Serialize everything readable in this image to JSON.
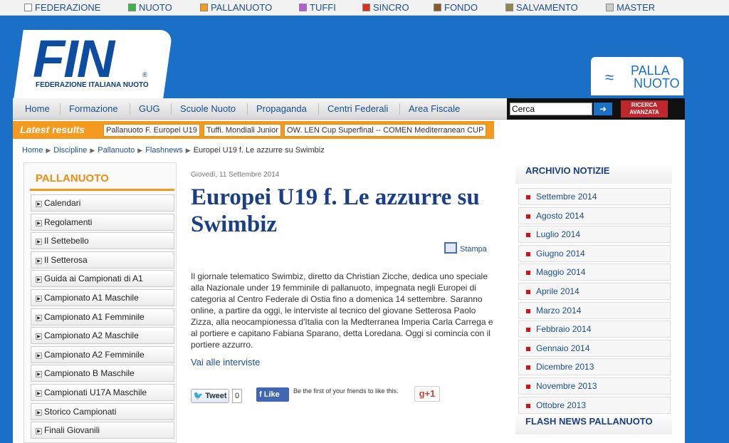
{
  "topbar": {
    "items": [
      {
        "label": "FEDERAZIONE",
        "color": "#ffffff"
      },
      {
        "label": "NUOTO",
        "color": "#3bb54a"
      },
      {
        "label": "PALLANUOTO",
        "color": "#f39a1f"
      },
      {
        "label": "TUFFI",
        "color": "#b45fd1"
      },
      {
        "label": "SINCRO",
        "color": "#d9341c"
      },
      {
        "label": "FONDO",
        "color": "#8a5a2b"
      },
      {
        "label": "SALVAMENTO",
        "color": "#8e8a4e"
      },
      {
        "label": "MASTER",
        "color": "#cccccc"
      }
    ]
  },
  "header": {
    "logo_text": "FIN",
    "logo_registered": "®",
    "logo_subtitle": "FEDERAZIONE ITALIANA NUOTO",
    "section_logo_line1": "PALLA",
    "section_logo_line2": "NUOTO"
  },
  "nav": {
    "items": [
      "Home",
      "Formazione",
      "GUG",
      "Scuole Nuoto",
      "Propaganda",
      "Centri Federali",
      "Area Fiscale"
    ]
  },
  "search": {
    "value": "Cerca",
    "button_icon": "arrow-right-icon",
    "advanced_line1": "RICERCA",
    "advanced_line2": "AVANZATA"
  },
  "latest": {
    "title": "Latest results",
    "items": [
      "Pallanuoto F. Europei U19",
      "Tuffi. Mondiali Junior",
      "OW. LEN Cup Superfinal -- COMEN Mediterranean CUP"
    ]
  },
  "breadcrumb": {
    "items": [
      "Home",
      "Discipline",
      "Pallanuoto",
      "Flashnews"
    ],
    "current": "Europei U19 f. Le azzurre su Swimbiz"
  },
  "sidebar": {
    "title": "PALLANUOTO",
    "items": [
      "Calendari",
      "Regolamenti",
      "Il Settebello",
      "Il Setterosa",
      "Guida ai Campionati di A1",
      "Campionato A1 Maschile",
      "Campionato A1 Femminile",
      "Campionato A2 Maschile",
      "Campionato A2 Femminile",
      "Campionato B Maschile",
      "Campionati U17A Maschile",
      "Storico Campionati",
      "Finali Giovanili"
    ]
  },
  "article": {
    "date": "Giovedì, 11 Settembre 2014",
    "title": "Europei U19 f. Le azzurre su Swimbiz",
    "print_label": "Stampa",
    "body": "Il giornale telematico Swimbiz, diretto da Christian Zicche, dedica uno speciale alla Nazionale under 19 femminile di pallanuoto, impegnata negli Europei di categoria al Centro Federale di Ostia fino a domenica 14 settembre. Saranno online, a partire da oggi, le interviste al tecnico del giovane Setterosa Paolo Zizza, alla neocampionessa d'Italia con la Medterranea Imperia Carla Carrega e al portiere e capitano Fabiana Sparano, detta Loredana. Oggi si comincia con il portiere azzurro.",
    "more_link": "Vai alle interviste",
    "tweet_label": "Tweet",
    "tweet_count": "0",
    "like_label": "Like",
    "like_text": "Be the first of your friends to like this.",
    "gplus_label": "g+1"
  },
  "archive": {
    "title": "ARCHIVIO NOTIZIE",
    "items": [
      "Settembre 2014",
      "Agosto 2014",
      "Luglio 2014",
      "Giugno 2014",
      "Maggio 2014",
      "Aprile 2014",
      "Marzo 2014",
      "Febbraio 2014",
      "Gennaio 2014",
      "Dicembre 2013",
      "Novembre 2013",
      "Ottobre 2013"
    ]
  },
  "flash": {
    "title": "FLASH NEWS PALLANUOTO"
  }
}
